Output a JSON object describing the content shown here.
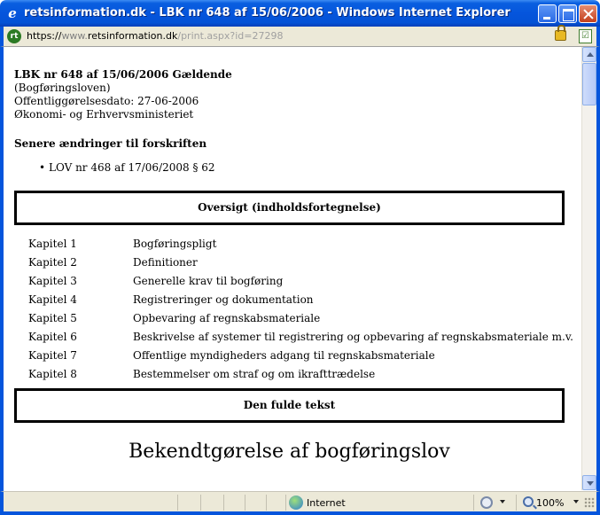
{
  "window": {
    "title": "retsinformation.dk - LBK nr 648 af 15/06/2006 - Windows Internet Explorer"
  },
  "address": {
    "protocol": "https://",
    "host_prefix": "www.",
    "host": "retsinformation.dk",
    "path": "/print.aspx?id=27298"
  },
  "document": {
    "title": "LBK nr 648 af 15/06/2006 Gældende",
    "short_name": "(Bogføringsloven)",
    "published": "Offentliggørelsesdato: 27-06-2006",
    "ministry": "Økonomi- og Erhvervsministeriet",
    "amendments_heading": "Senere ændringer til forskriften",
    "amendments": [
      "LOV nr 468 af 17/06/2008 § 62"
    ],
    "toc_heading": "Oversigt (indholdsfortegnelse)",
    "toc": [
      {
        "chapter": "Kapitel 1",
        "title": "Bogføringspligt"
      },
      {
        "chapter": "Kapitel 2",
        "title": "Definitioner"
      },
      {
        "chapter": "Kapitel 3",
        "title": "Generelle krav til bogføring"
      },
      {
        "chapter": "Kapitel 4",
        "title": "Registreringer og dokumentation"
      },
      {
        "chapter": "Kapitel 5",
        "title": "Opbevaring af regnskabsmateriale"
      },
      {
        "chapter": "Kapitel 6",
        "title": "Beskrivelse af systemer til registrering og opbevaring af regnskabsmateriale m.v."
      },
      {
        "chapter": "Kapitel 7",
        "title": "Offentlige myndigheders adgang til regnskabsmateriale"
      },
      {
        "chapter": "Kapitel 8",
        "title": "Bestemmelser om straf og om ikrafttrædelse"
      }
    ],
    "full_text_heading": "Den fulde tekst",
    "main_heading": "Bekendtgørelse af bogføringslov"
  },
  "status": {
    "zone": "Internet",
    "zoom": "100%"
  },
  "colors": {
    "titlebar": "#0555dc",
    "chrome": "#ece9d8"
  }
}
